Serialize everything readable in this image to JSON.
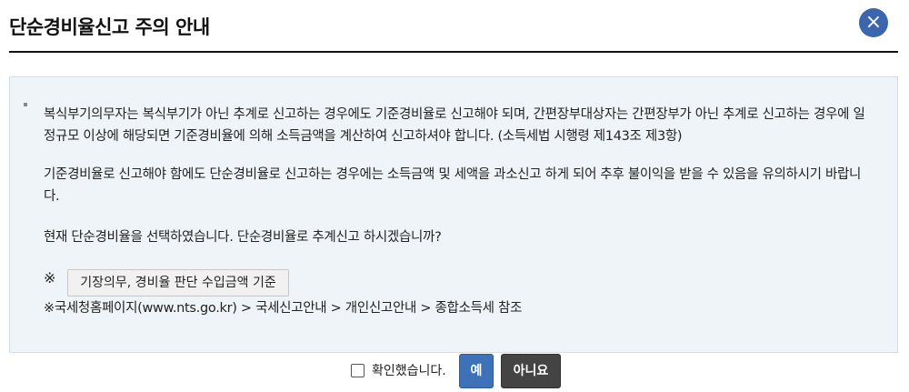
{
  "dialog": {
    "title": "단순경비율신고 주의 안내",
    "close_icon": "×"
  },
  "notice": {
    "bullet_icon": "square-bullet",
    "paragraph1_line1": "복식부기의무자는 복식부기가 아닌 추계로 신고하는 경우에도 기준경비율로 신고해야 되며, 간편장부대상자는 간편장부가 아닌 추계로 신고하는 경우에 일",
    "paragraph1_line2": "정규모 이상에 해당되면 기준경비율에 의해 소득금액을 계산하여 신고하셔야 합니다. (소득세법 시행령 제143조 제3항)",
    "paragraph2_line1": "기준경비율로 신고해야 함에도 단순경비율로 신고하는 경우에는 소득금액 및 세액을 과소신고 하게 되어 추후 불이익을 받을 수 있음을 유의하시기 바랍니",
    "paragraph2_line2": "다.",
    "paragraph3": "현재 단순경비율을 선택하였습니다. 단순경비율로 추계신고 하시겠습니까?",
    "ref_mark": "※",
    "criteria_button_label": "기장의무, 경비율 판단 수입금액 기준",
    "reference_path": "※국세청홈페이지(www.nts.go.kr) > 국세신고안내 > 개인신고안내 > 종합소득세 참조"
  },
  "footer": {
    "confirm_label": "확인했습니다.",
    "confirm_checked": false,
    "yes_label": "예",
    "no_label": "아니요"
  },
  "colors": {
    "close_button": "#3b66ae",
    "notice_background": "#eef4f7",
    "yes_button": "#3d72b8",
    "no_button": "#444444"
  }
}
